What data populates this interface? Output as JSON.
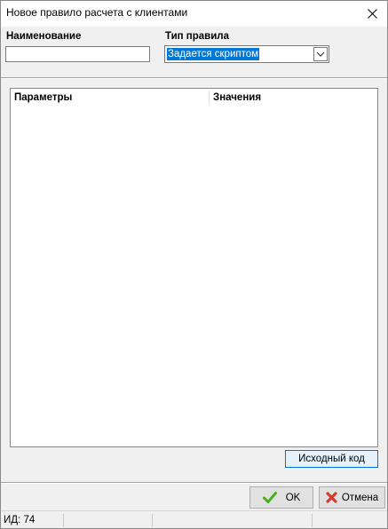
{
  "window": {
    "title": "Новое правило расчета с клиентами"
  },
  "form": {
    "name_label": "Наименование",
    "name_value": "",
    "type_label": "Тип правила",
    "type_value": "Задается скриптом"
  },
  "grid": {
    "columns": [
      "Параметры",
      "Значения"
    ]
  },
  "buttons": {
    "source_code": "Исходный код",
    "ok": "OK",
    "cancel": "Отмена"
  },
  "status": {
    "id_text": "ИД: 74"
  },
  "colors": {
    "selection": "#0078d7",
    "ok_icon": "#4caf1a",
    "cancel_icon": "#d83a2a"
  },
  "icons": {
    "close": "close-icon",
    "dropdown": "chevron-down-icon",
    "ok": "checkmark-icon",
    "cancel": "cross-icon"
  }
}
